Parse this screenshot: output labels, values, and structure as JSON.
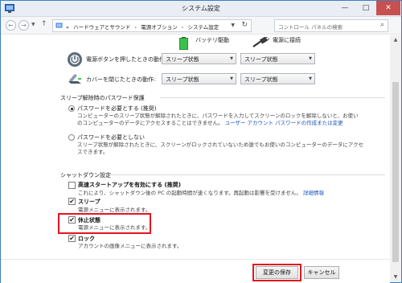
{
  "window": {
    "title": "システム設定",
    "min_glyph": "—",
    "max_glyph": "□",
    "close_glyph": "✕"
  },
  "navigation": {
    "back_glyph": "←",
    "forward_glyph": "→",
    "dropdown_glyph": "▼",
    "up_glyph": "↑",
    "breadcrumbs": {
      "prefix": "«",
      "item1": "ハードウェアとサウンド",
      "item2": "電源オプション",
      "item3": "システム設定"
    },
    "separator": "›",
    "refresh_glyph": "↻",
    "search_placeholder": "コントロール パネルの検索",
    "search_glyph": "⌕"
  },
  "power_table": {
    "battery_label": "バッテリ駆動",
    "plugged_label": "電源に接続",
    "rows": [
      {
        "label": "電源ボタンを押したときの動作:",
        "battery_value": "スリープ状態",
        "plugged_value": "スリープ状態"
      },
      {
        "label": "カバーを閉じたときの動作:",
        "battery_value": "スリープ状態",
        "plugged_value": "スリープ状態"
      }
    ]
  },
  "wake_password": {
    "heading": "スリープ解除時のパスワード保護",
    "require": {
      "label": "パスワードを必要とする (推奨)",
      "selected": true,
      "desc_line1": "コンピューターのスリープ状態が解除されたときに、パスワードを入力してスクリーンのロックを解除しないと、お使い",
      "desc_line2": "のコンピューターのデータにアクセスすることはできません。",
      "link": "ユーザー アカウント パスワードの作成または変更"
    },
    "not_require": {
      "label": "パスワードを必要としない",
      "selected": false,
      "desc_line1": "スリープ状態が解除されたときに、スクリーンがロックされていないため誰でもお使いのコンピューターのデータにアクセ",
      "desc_line2": "スできます。"
    }
  },
  "shutdown": {
    "heading": "シャットダウン設定",
    "check_glyph": "✔",
    "fast_startup": {
      "label": "高速スタートアップを有効にする (推奨)",
      "checked": false,
      "desc": "これにより、シャットダウン後の PC の起動時間が速くなります。再起動は影響を受けません。",
      "link": "詳細情報"
    },
    "sleep": {
      "label": "スリープ",
      "checked": true,
      "desc": "電源メニューに表示されます。"
    },
    "hibernate": {
      "label": "休止状態",
      "checked": true,
      "desc": "電源メニューに表示されます。"
    },
    "lock": {
      "label": "ロック",
      "checked": true,
      "desc": "アカウントの画像メニューに表示されます。"
    }
  },
  "footer": {
    "save_label": "変更の保存",
    "cancel_label": "キャンセル"
  },
  "scrollbar": {
    "up_glyph": "▲",
    "down_glyph": "▼"
  },
  "colors": {
    "highlight": "#e4141d",
    "link": "#1a55c2",
    "close_button": "#c75050"
  }
}
